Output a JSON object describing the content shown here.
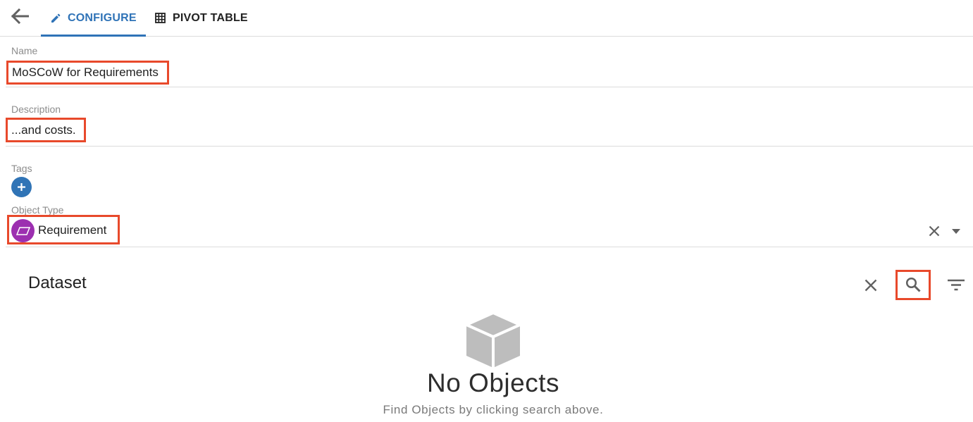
{
  "header": {
    "tabs": [
      {
        "label": "CONFIGURE",
        "icon": "pencil-icon",
        "active": true
      },
      {
        "label": "PIVOT TABLE",
        "icon": "grid-icon",
        "active": false
      }
    ]
  },
  "form": {
    "name": {
      "label": "Name",
      "value": "MoSCoW for Requirements"
    },
    "description": {
      "label": "Description",
      "value": "...and costs."
    },
    "tags": {
      "label": "Tags"
    },
    "object_type": {
      "label": "Object Type",
      "value": "Requirement",
      "icon": "parallelogram-icon"
    }
  },
  "dataset": {
    "title": "Dataset",
    "empty_title": "No Objects",
    "empty_subtitle": "Find Objects by clicking search above."
  },
  "colors": {
    "accent": "#2f73b7",
    "highlight": "#e8492b",
    "object_type_avatar": "#9c2fb0",
    "tag_add": "#3074b6"
  }
}
